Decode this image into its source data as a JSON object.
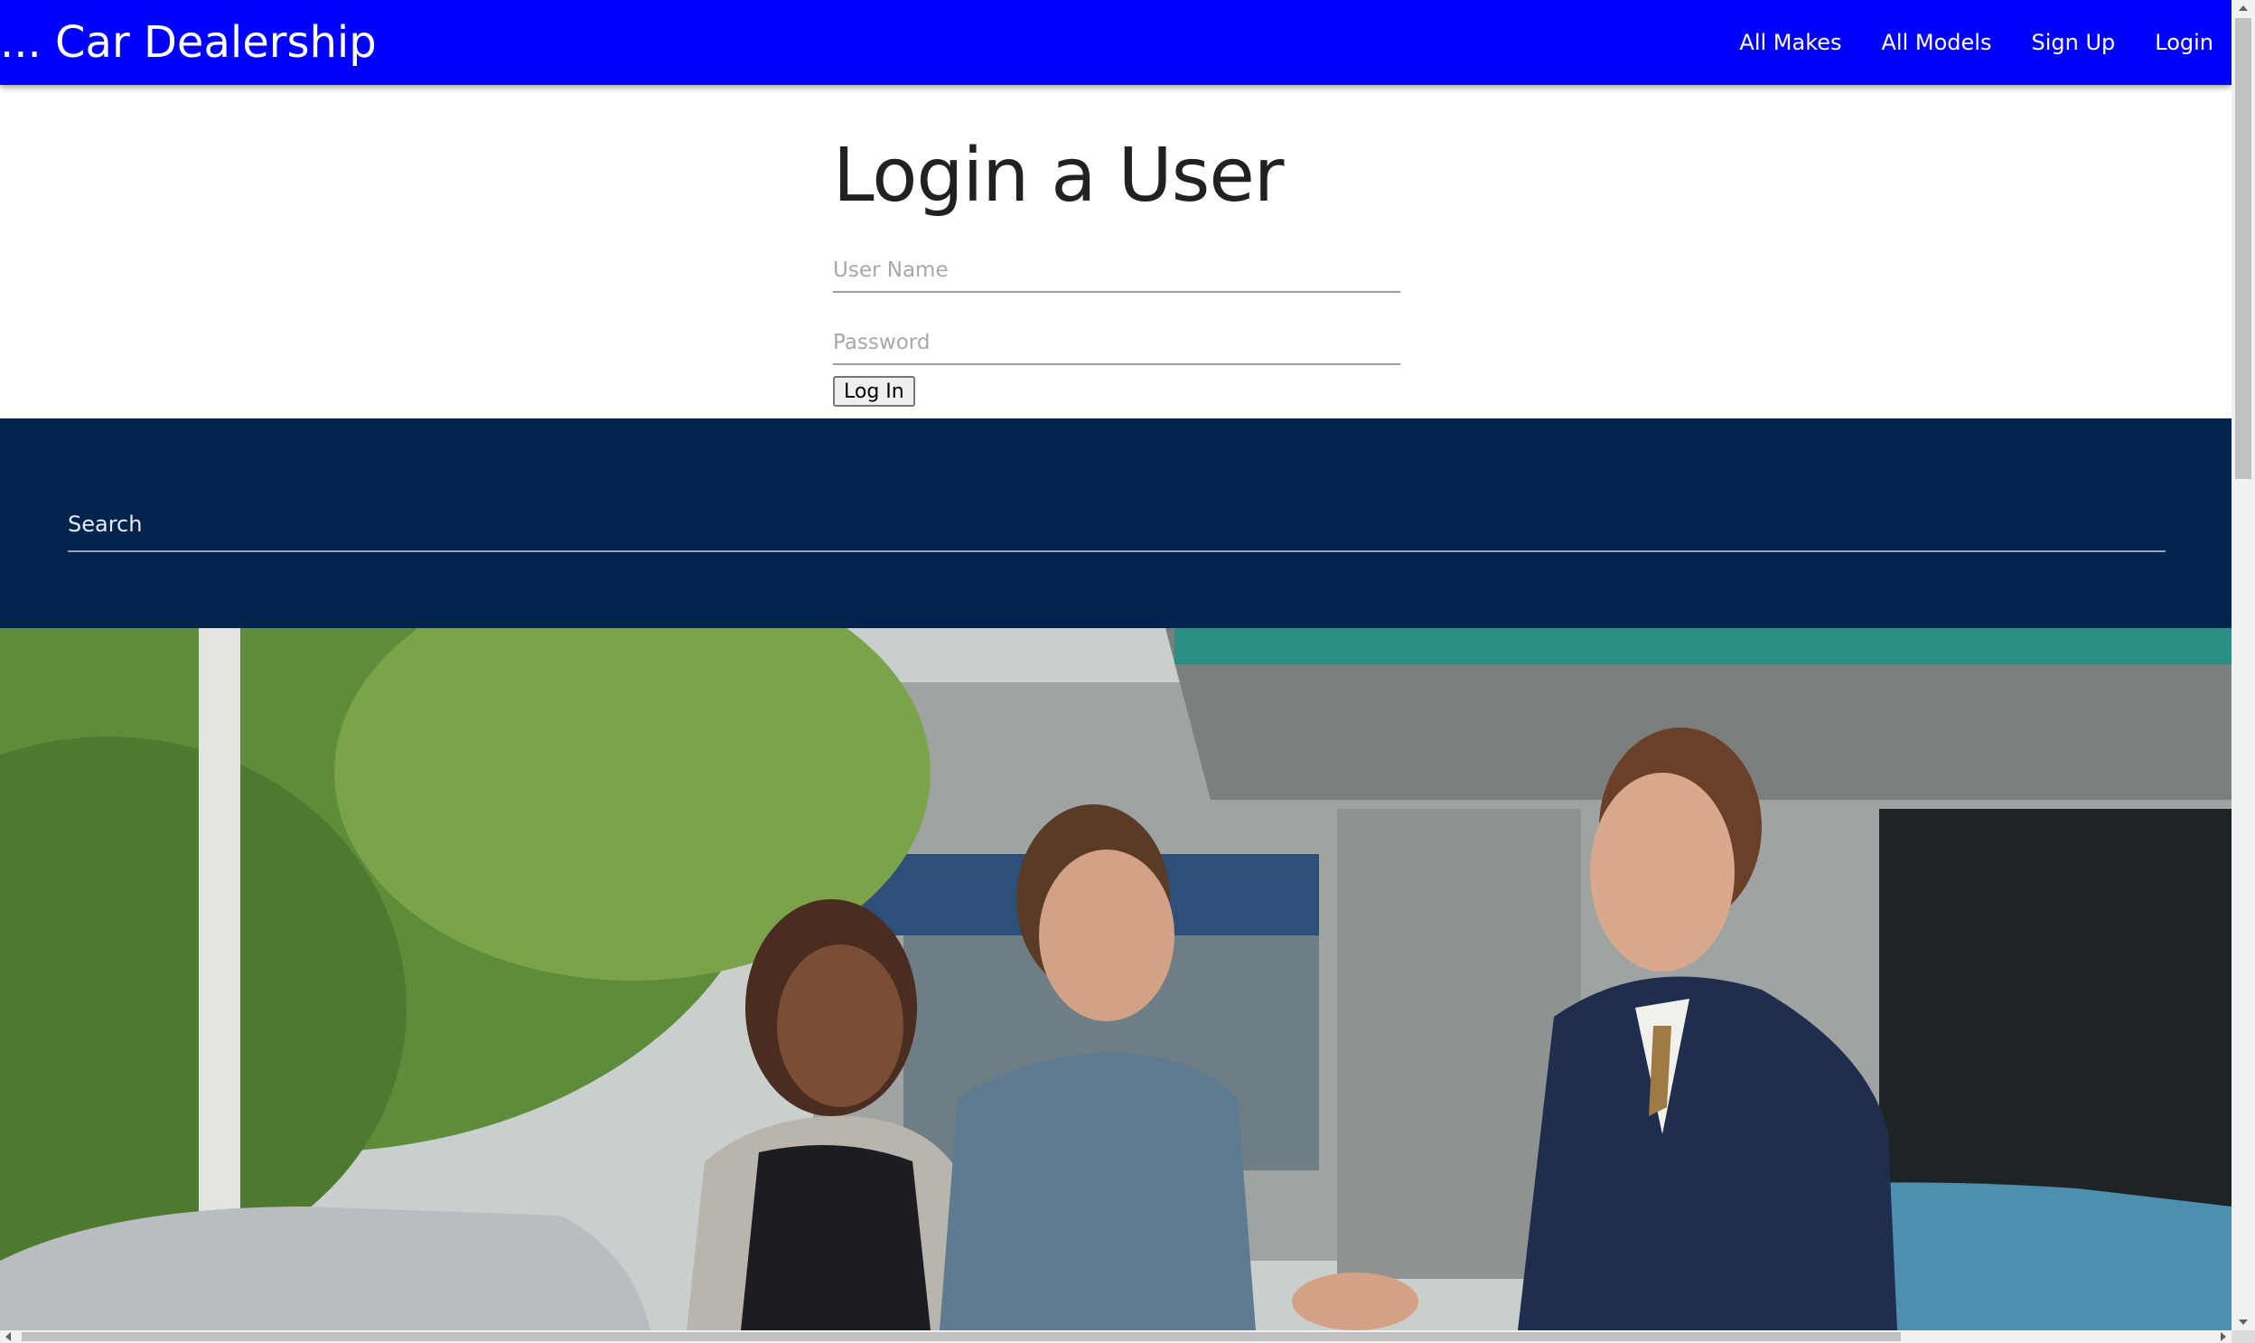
{
  "navbar": {
    "brand": "... Car Dealership",
    "links": [
      "All Makes",
      "All Models",
      "Sign Up",
      "Login"
    ],
    "background": "#0000fe"
  },
  "login": {
    "title": "Login a User",
    "username_placeholder": "User Name",
    "password_placeholder": "Password",
    "submit_label": "Log In"
  },
  "search": {
    "placeholder": "Search",
    "background": "#01244f"
  },
  "hero": {
    "description_icon": "hero-photo"
  }
}
